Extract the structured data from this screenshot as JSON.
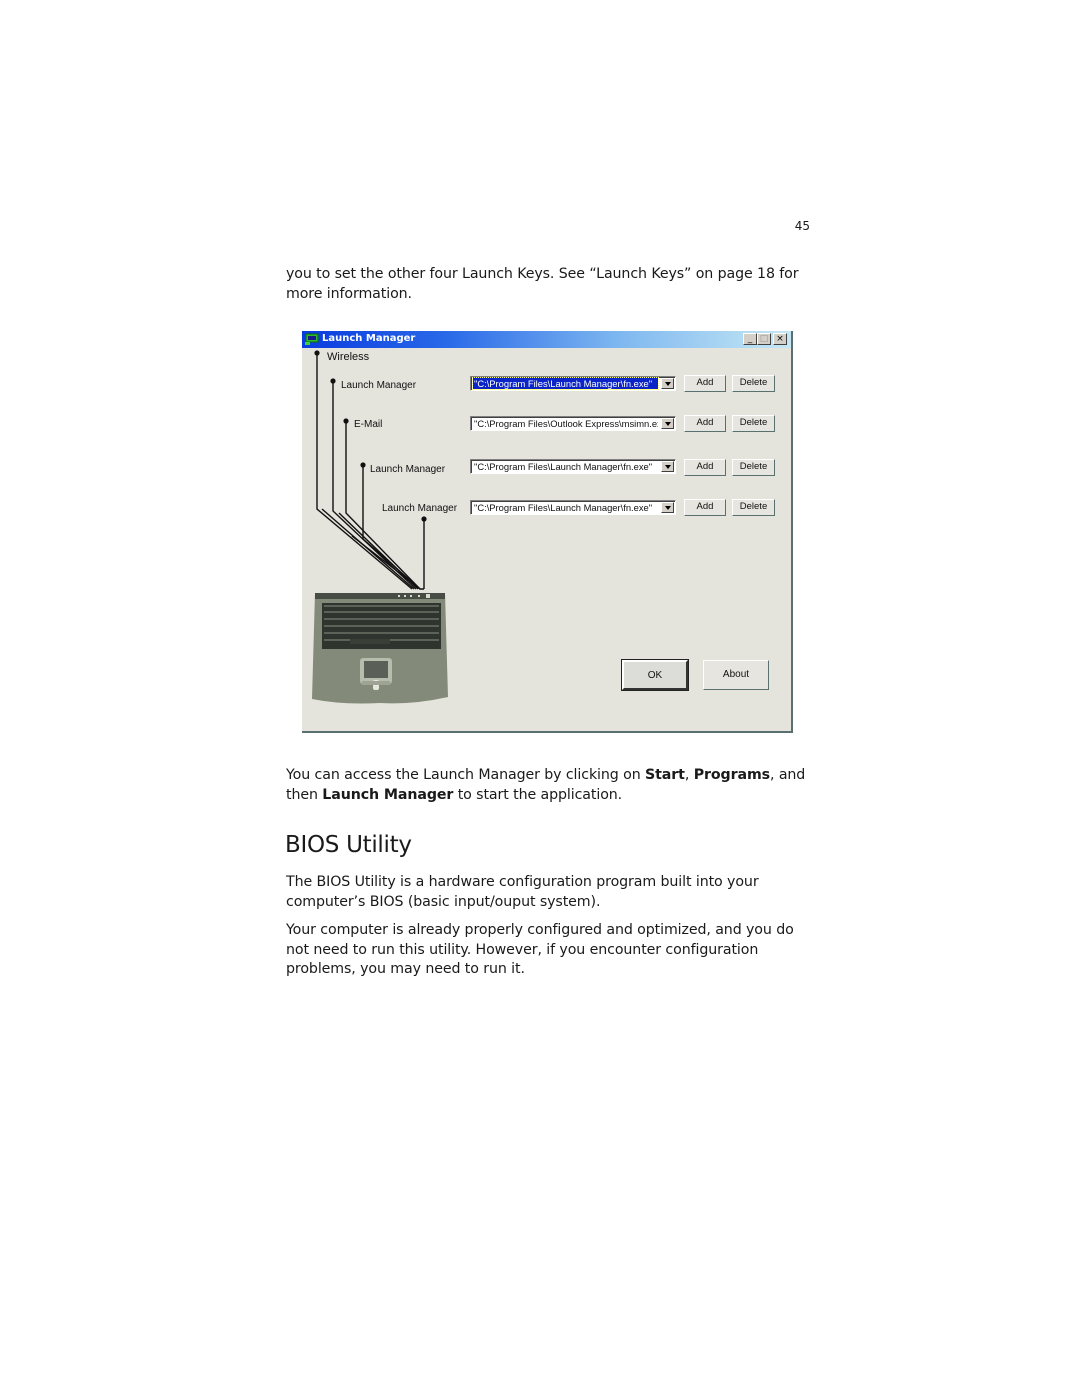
{
  "page": {
    "number": "45",
    "intro_text": "you to set the other four Launch Keys.  See “Launch Keys” on page 18 for more information.",
    "access_para": {
      "part1": "You can access the Launch Manager by clicking on ",
      "bold1": "Start",
      "sep1": ", ",
      "bold2": "Programs",
      "sep2": ",",
      "part2": " and then ",
      "bold3": "Launch Manager",
      "part3": " to start the application."
    },
    "heading": "BIOS Utility",
    "bios_para1": "The BIOS Utility is a hardware configuration program built into your computer’s BIOS (basic input/ouput system).",
    "bios_para2": "Your computer is already properly configured and optimized, and you do not need to run this utility.  However, if you encounter configuration problems, you may need to run it."
  },
  "window": {
    "title": "Launch Manager",
    "minimize": "_",
    "maximize": "□",
    "close": "×",
    "group_label": "Wireless",
    "rows": [
      {
        "label": "Launch Manager",
        "value": "\"C:\\Program Files\\Launch Manager\\fn.exe\"",
        "selected": true
      },
      {
        "label": "E-Mail",
        "value": "\"C:\\Program Files\\Outlook Express\\msimn.exe\"",
        "selected": false
      },
      {
        "label": "Launch Manager",
        "value": "\"C:\\Program Files\\Launch Manager\\fn.exe\"",
        "selected": false
      },
      {
        "label": "Launch Manager",
        "value": "\"C:\\Program Files\\Launch Manager\\fn.exe\"",
        "selected": false
      }
    ],
    "add_label": "Add",
    "delete_label": "Delete",
    "ok_label": "OK",
    "about_label": "About"
  }
}
